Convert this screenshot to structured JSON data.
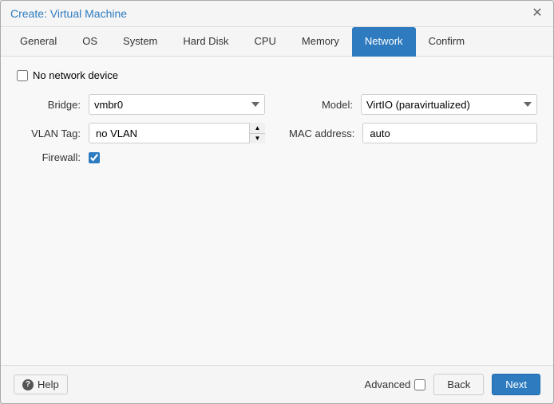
{
  "dialog": {
    "title": "Create: Virtual Machine",
    "close_label": "×"
  },
  "tabs": [
    {
      "id": "general",
      "label": "General",
      "active": false
    },
    {
      "id": "os",
      "label": "OS",
      "active": false
    },
    {
      "id": "system",
      "label": "System",
      "active": false
    },
    {
      "id": "hard-disk",
      "label": "Hard Disk",
      "active": false
    },
    {
      "id": "cpu",
      "label": "CPU",
      "active": false
    },
    {
      "id": "memory",
      "label": "Memory",
      "active": false
    },
    {
      "id": "network",
      "label": "Network",
      "active": true
    },
    {
      "id": "confirm",
      "label": "Confirm",
      "active": false
    }
  ],
  "form": {
    "no_device_label": "No network device",
    "bridge_label": "Bridge:",
    "bridge_value": "vmbr0",
    "model_label": "Model:",
    "model_value": "VirtIO (paravirtualized)",
    "vlan_label": "VLAN Tag:",
    "vlan_value": "no VLAN",
    "mac_label": "MAC address:",
    "mac_value": "auto",
    "firewall_label": "Firewall:",
    "firewall_checked": true
  },
  "footer": {
    "help_label": "Help",
    "advanced_label": "Advanced",
    "back_label": "Back",
    "next_label": "Next"
  },
  "icons": {
    "help": "?",
    "close": "✕",
    "chevron_up": "▲",
    "chevron_down": "▼"
  }
}
